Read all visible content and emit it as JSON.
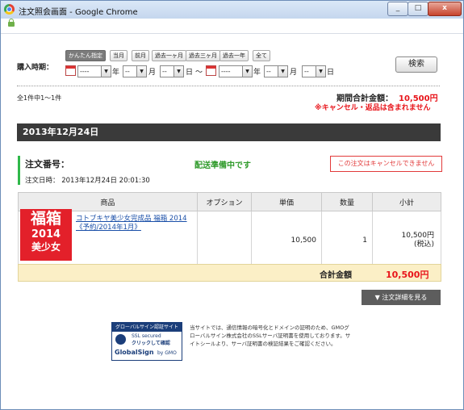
{
  "window": {
    "title": "注文照会画面 - Google Chrome",
    "min": "_",
    "max": "□",
    "close": "x"
  },
  "period": {
    "label": "購入時期：",
    "quick": [
      "かんたん指定",
      "当月",
      "前月",
      "過去一ヶ月",
      "過去三ヶ月",
      "過去一年",
      "全て"
    ],
    "from": {
      "year": "----",
      "month": "--",
      "day": "--"
    },
    "to": {
      "year": "----",
      "month": "--",
      "day": "--"
    },
    "unit_year": "年",
    "unit_month": "月",
    "unit_day": "日",
    "tilde": "～",
    "search": "検索"
  },
  "summary": {
    "count": "全1件中1～1件",
    "total_label": "期間合計金額：",
    "total_value": "10,500円",
    "note": "※キャンセル・返品は含まれません"
  },
  "order": {
    "date_header": "2013年12月24日",
    "number_label": "注文番号：",
    "status": "配送準備中です",
    "datetime": "注文日時： 2013年12月24日 20:01:30",
    "cancel_note": "この注文はキャンセルできません"
  },
  "table": {
    "headers": [
      "商品",
      "オプション",
      "単価",
      "数量",
      "小計"
    ],
    "rows": [
      {
        "image_text": [
          "福箱",
          "2014",
          "美少女"
        ],
        "product": "コトブキヤ美少女完成品 福箱 2014《予約/2014年1月》",
        "option": "",
        "price": "10,500",
        "qty": "1",
        "subtotal": "10,500円",
        "tax": "(税込)"
      }
    ],
    "total_label": "合計金額",
    "total_value": "10,500円"
  },
  "detail_button": "▼ 注文詳細を見る",
  "footer": {
    "seal_title": "グローバルサイン認証サイト",
    "seal_line1": "SSL secured",
    "seal_line2": "クリックして確認",
    "seal_brand": "GlobalSign",
    "seal_by": "by GMO",
    "text": "当サイトでは、通信情報の暗号化とドメインの証明のため、GMOグローバルサイン株式会社のSSLサーバ証明書を使用しております。サイトシールより、サーバ証明書の検証結果をご確認ください。"
  },
  "colors": {
    "accent_red": "#e8141a",
    "status_green": "#2f9a2a",
    "date_bar": "#3a3a3a",
    "total_bg": "#fbefc6"
  }
}
